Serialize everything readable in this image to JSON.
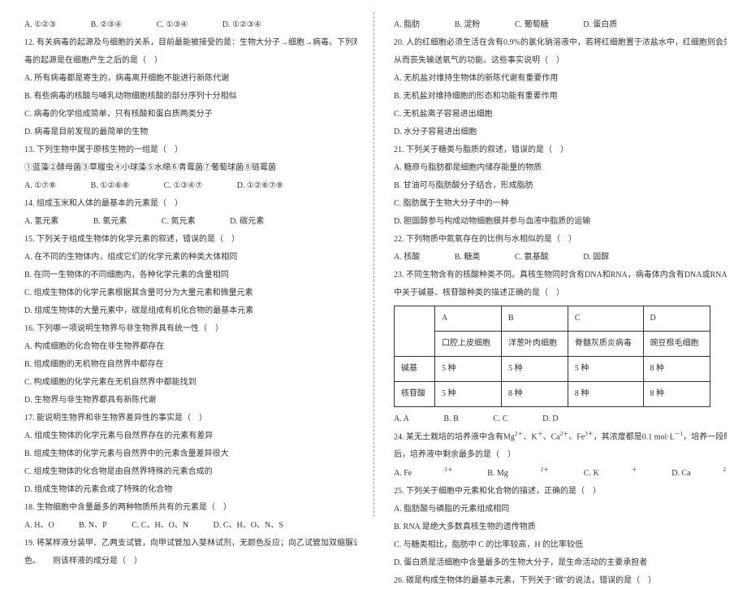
{
  "left": {
    "q11_opts": [
      "A. ①②③",
      "B. ②③④",
      "C. ①③④",
      "D. ①②③④"
    ],
    "q12_line1": "12. 有关病毒的起源及与细胞的关系，目前最能被接受的是：生物大分子→细胞→病毒。下列观点能支持病",
    "q12_line2": "毒的起源是在细胞产生之后的是（　）",
    "q12_a": "A. 所有病毒都是寄生的，病毒离开细胞不能进行新陈代谢",
    "q12_b": "B. 有些病毒的核酸与哺乳动物细胞核酸的部分序列十分相似",
    "q12_c": "C. 病毒的化学组成简单，只有核酸和蛋白质两类分子",
    "q12_d": "D. 病毒是目前发现的最简单的生物",
    "q13_line1": "13. 下列生物中属于原核生物的一组是（　）",
    "q13_line2": "①蓝藻②酵母菌③草履虫④小球藻⑤水绵⑥青霉菌⑦葡萄球菌⑧链霉菌",
    "q13_opts": [
      "A. ①⑦⑧",
      "B. ①②⑥⑧",
      "C. ①③④⑦",
      "D. ①②⑥⑦⑧"
    ],
    "q14": "14. 组成玉米和人体的最基本的元素是（　）",
    "q14_opts": [
      "A. 氢元素",
      "B. 氧元素",
      "C. 氮元素",
      "D. 碳元素"
    ],
    "q15": "15. 下列关于组成生物体的化学元素的叙述，错误的是（　）",
    "q15_a": "A. 在不同的生物体内，组成它们的化学元素的种类大体相同",
    "q15_b": "B. 在同一生物体的不同细胞内，各种化学元素的含量相同",
    "q15_c": "C. 组成生物体的化学元素根据其含量可分为大量元素和微量元素",
    "q15_d": "D. 组成生物体的大量元素中，碳是组成有机化合物的最基本元素",
    "q16": "16. 下列哪一项说明生物界与非生物界具有统一性（　）",
    "q16_a": "A. 构成细胞的化合物在非生物界都存在",
    "q16_b": "B. 组成细胞的无机物在自然界中都存在",
    "q16_c": "C. 构成细胞的化学元素在无机自然界中都能找到",
    "q16_d": "D. 生物界与非生物界都具有新陈代谢",
    "q17": "17. 能说明生物界和非生物界差异性的事实是（　）",
    "q17_a": "A. 组成生物体的化学元素与自然界存在的元素有差异",
    "q17_b": "B. 组成生物体的化学元素与自然界中的元素含量差异很大",
    "q17_c": "C. 组成生物体的化合物是由自然界特殊的元素合成的",
    "q17_d": "D. 组成生物体的元素合成了特殊的化合物",
    "q18": "18. 生物细胞中含量最多的两种物质所共有的元素是（　）",
    "q18_opts": [
      "A. H、O",
      "B. N、P",
      "C. C、H、O、N",
      "D. C、H、O、N、S"
    ],
    "q19_line1": "19. 将某样液分装甲、乙两支试管，向甲试管加入斐林试剂，无颜色反应；向乙试管加双缩脲试剂后呈紫",
    "q19_line2": "色。　　则该样液的成分是（　）"
  },
  "right": {
    "q19_opts": [
      "A. 脂肪",
      "B. 淀粉",
      "C. 葡萄糖",
      "D. 蛋白质"
    ],
    "q20_line1": "20. 人的红细胞必须生活在含有0.9%的氯化钠溶液中，若将红细胞置于浓盐水中，红细胞则会失去水皱缩，",
    "q20_line2": "从而丧失输送氧气的功能。这些事实说明（　）",
    "q20_a": "A. 无机盐对维持生物体的新陈代谢有重要作用",
    "q20_b": "B. 无机盐对维持细胞的形态和功能有重要作用",
    "q20_c": "C. 无机盐离子容易进出细胞",
    "q20_d": "D. 水分子容易进出细胞",
    "q21": "21. 下列关于糖类与脂质的叙述，错误的是（　）",
    "q21_a": "A. 糖原与脂肪都是细胞内储存能量的物质",
    "q21_b": "B. 甘油可与脂肪酸分子结合，形成脂肪",
    "q21_c": "C. 脂肪属于生物大分子中的一种",
    "q21_d": "D. 胆固醇参与构成动物细胞膜并参与血液中脂质的运输",
    "q22": "22. 下列物质中氮氧存在的比例与水相似的是（　）",
    "q22_opts": [
      "A. 核酸",
      "B. 糖类",
      "C. 氨基酸",
      "D. 固醇"
    ],
    "q23_line1": "23. 不同生物含有的核酸种类不同。真核生物同时含有DNA和RNA，病毒体内含有DNA或RNA。下列各种生物学",
    "q23_line2": "中关于碱基、核苷酸种类的描述正确的是（　）",
    "table": {
      "headers": [
        "",
        "A",
        "B",
        "C",
        "D"
      ],
      "sub": [
        "",
        "口腔上皮细胞",
        "洋葱叶肉细胞",
        "脊髓灰质炎病毒",
        "豌豆根毛细胞"
      ],
      "row1": [
        "碱基",
        "5 种",
        "5 种",
        "5 种",
        "8 种"
      ],
      "row2": [
        "核苷酸",
        "5 种",
        "8 种",
        "8 种",
        "8 种"
      ]
    },
    "q23_opts": [
      "A. A",
      "B. B",
      "C. C",
      "D. D"
    ],
    "q24_line1a": "24. 某无土栽培的培养液中含有Mg",
    "q24_line1b": "、K",
    "q24_line1c": "、Ca",
    "q24_line1d": "、Fe",
    "q24_line1e": "，其浓度都是0.1 mol·L",
    "q24_line1f": "，培养一段时间",
    "q24_line2": "后，培养液中剩余最多的是（　）",
    "q24_a": "A. Fe",
    "q24_b": "B. Mg",
    "q24_c": "C. K",
    "q24_d": "D. Ca",
    "q25": "25. 下列关于细胞中元素和化合物的描述，正确的是（　）",
    "q25_a": "A. 脂肪酸与磷脂的元素组成相同",
    "q25_b": "B. RNA 是绝大多数真核生物的遗传物质",
    "q25_c": "C. 与糖类相比，脂肪中 C 的比率较高，H 的比率较低",
    "q25_d": "D. 蛋白质是活细胞中含量最多的生物大分子，是生命活动的主要承担者",
    "q26": "26. 碳是构成生物体的最基本元素，下列关于\"碳\"的说法，错误的是（　）"
  }
}
